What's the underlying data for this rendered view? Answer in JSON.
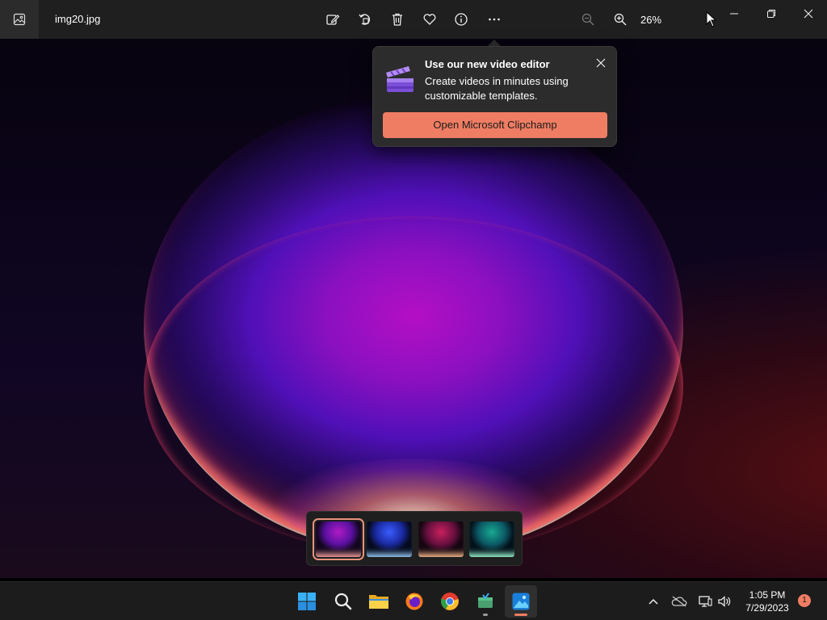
{
  "window": {
    "file_name": "img20.jpg",
    "zoom_level": "26%"
  },
  "toolbar": {
    "icons": [
      "edit-image-icon",
      "rotate-icon",
      "delete-icon",
      "favorite-icon",
      "info-icon",
      "more-options-icon"
    ],
    "zoom_out_icon": "zoom-out-icon",
    "zoom_in_icon": "zoom-in-icon"
  },
  "popup": {
    "title": "Use our new video editor",
    "body": "Create videos in minutes using customizable templates.",
    "button_label": "Open Microsoft Clipchamp",
    "icon": "clipchamp-icon"
  },
  "filmstrip": {
    "thumbnails": [
      {
        "name": "thumbnail-1",
        "selected": true,
        "accent": "#a020c0"
      },
      {
        "name": "thumbnail-2",
        "selected": false,
        "accent": "#3060ff"
      },
      {
        "name": "thumbnail-3",
        "selected": false,
        "accent": "#e03060"
      },
      {
        "name": "thumbnail-4",
        "selected": false,
        "accent": "#20c090"
      }
    ]
  },
  "taskbar": {
    "apps": [
      "start-icon",
      "search-icon",
      "file-explorer-icon",
      "firefox-icon",
      "chrome-icon",
      "app-installer-icon",
      "photos-icon"
    ],
    "tray_icons": [
      "chevron-up-icon",
      "onedrive-icon",
      "network-icon",
      "volume-icon"
    ],
    "time": "1:05 PM",
    "date": "7/29/2023",
    "notification_count": "1"
  },
  "colors": {
    "accent": "#ef7d63",
    "titlebar": "#1f1f1f",
    "taskbar": "#1c1c1c"
  }
}
